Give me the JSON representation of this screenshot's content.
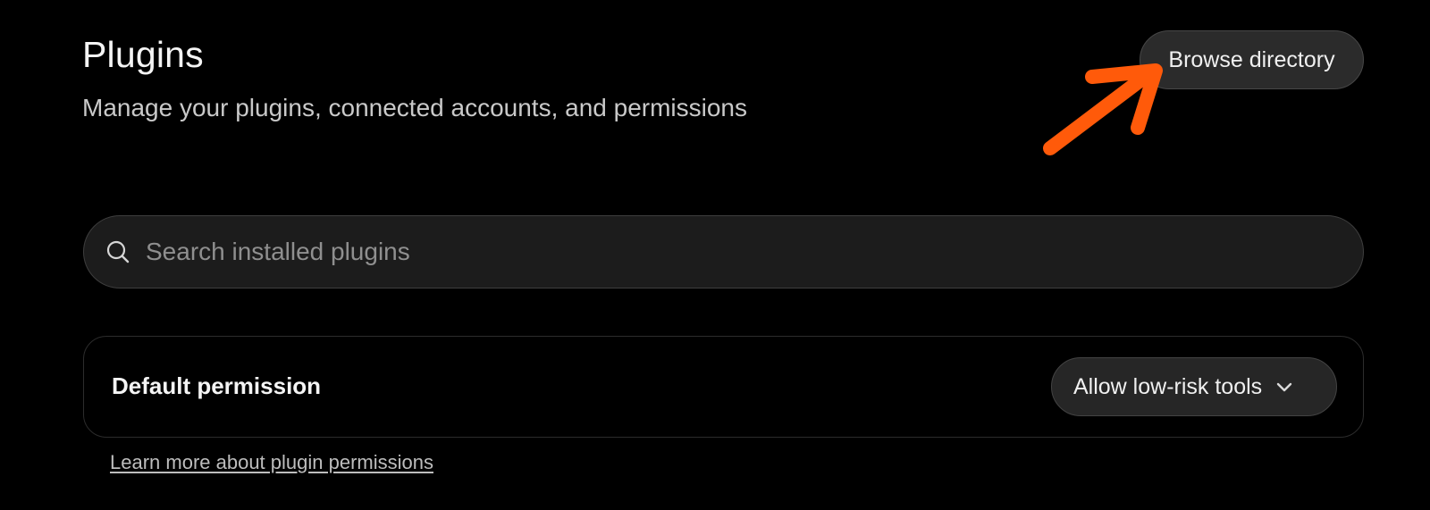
{
  "header": {
    "title": "Plugins",
    "subtitle": "Manage your plugins, connected accounts, and permissions",
    "browse_button_label": "Browse directory"
  },
  "search": {
    "placeholder": "Search installed plugins",
    "value": "",
    "icon": "search-icon"
  },
  "permissions": {
    "label": "Default permission",
    "selected_value": "Allow low-risk tools",
    "dropdown_icon": "chevron-down-icon"
  },
  "learn_more": {
    "link_text": "Learn more about plugin permissions"
  },
  "colors": {
    "background": "#000000",
    "annotation_arrow": "#ff5a0a",
    "button_background": "#2b2b2b",
    "search_background": "#1c1c1c"
  }
}
